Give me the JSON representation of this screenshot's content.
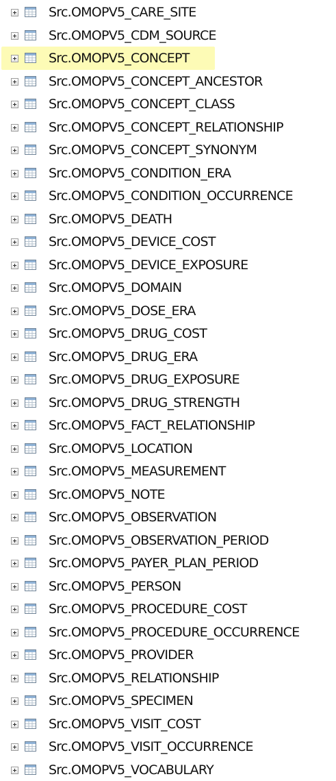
{
  "tree": {
    "selected_index": 2,
    "highlight_color": "#fdfbb6",
    "expander_icon": "plus-expander-icon",
    "node_icon": "table-icon",
    "items": [
      "Src.OMOPV5_CARE_SITE",
      "Src.OMOPV5_CDM_SOURCE",
      "Src.OMOPV5_CONCEPT",
      "Src.OMOPV5_CONCEPT_ANCESTOR",
      "Src.OMOPV5_CONCEPT_CLASS",
      "Src.OMOPV5_CONCEPT_RELATIONSHIP",
      "Src.OMOPV5_CONCEPT_SYNONYM",
      "Src.OMOPV5_CONDITION_ERA",
      "Src.OMOPV5_CONDITION_OCCURRENCE",
      "Src.OMOPV5_DEATH",
      "Src.OMOPV5_DEVICE_COST",
      "Src.OMOPV5_DEVICE_EXPOSURE",
      "Src.OMOPV5_DOMAIN",
      "Src.OMOPV5_DOSE_ERA",
      "Src.OMOPV5_DRUG_COST",
      "Src.OMOPV5_DRUG_ERA",
      "Src.OMOPV5_DRUG_EXPOSURE",
      "Src.OMOPV5_DRUG_STRENGTH",
      "Src.OMOPV5_FACT_RELATIONSHIP",
      "Src.OMOPV5_LOCATION",
      "Src.OMOPV5_MEASUREMENT",
      "Src.OMOPV5_NOTE",
      "Src.OMOPV5_OBSERVATION",
      "Src.OMOPV5_OBSERVATION_PERIOD",
      "Src.OMOPV5_PAYER_PLAN_PERIOD",
      "Src.OMOPV5_PERSON",
      "Src.OMOPV5_PROCEDURE_COST",
      "Src.OMOPV5_PROCEDURE_OCCURRENCE",
      "Src.OMOPV5_PROVIDER",
      "Src.OMOPV5_RELATIONSHIP",
      "Src.OMOPV5_SPECIMEN",
      "Src.OMOPV5_VISIT_COST",
      "Src.OMOPV5_VISIT_OCCURRENCE",
      "Src.OMOPV5_VOCABULARY"
    ]
  }
}
